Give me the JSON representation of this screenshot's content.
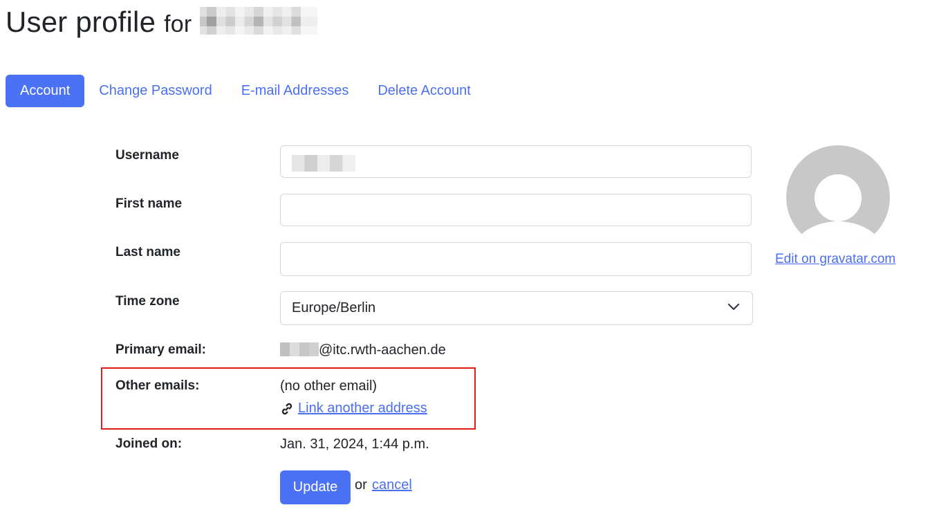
{
  "header": {
    "title": "User profile",
    "for_word": "for",
    "username_masked": ""
  },
  "tabs": [
    {
      "label": "Account",
      "active": true
    },
    {
      "label": "Change Password",
      "active": false
    },
    {
      "label": "E-mail Addresses",
      "active": false
    },
    {
      "label": "Delete Account",
      "active": false
    }
  ],
  "form": {
    "username_label": "Username",
    "username_value": "",
    "first_name_label": "First name",
    "first_name_value": "",
    "last_name_label": "Last name",
    "last_name_value": "",
    "time_zone_label": "Time zone",
    "time_zone_value": "Europe/Berlin",
    "primary_email_label": "Primary email:",
    "primary_email_domain": "@itc.rwth-aachen.de",
    "other_emails_label": "Other emails:",
    "other_emails_value": "(no other email)",
    "link_another_label": "Link another address",
    "joined_label": "Joined on:",
    "joined_value": "Jan. 31, 2024, 1:44 p.m.",
    "update_label": "Update",
    "or_text": "or",
    "cancel_label": "cancel"
  },
  "avatar": {
    "edit_link": "Edit on gravatar.com"
  },
  "colors": {
    "accent": "#4b72f5",
    "link": "#4a6ff0",
    "highlight": "#e01b1b",
    "avatar": "#c8c8c8"
  }
}
